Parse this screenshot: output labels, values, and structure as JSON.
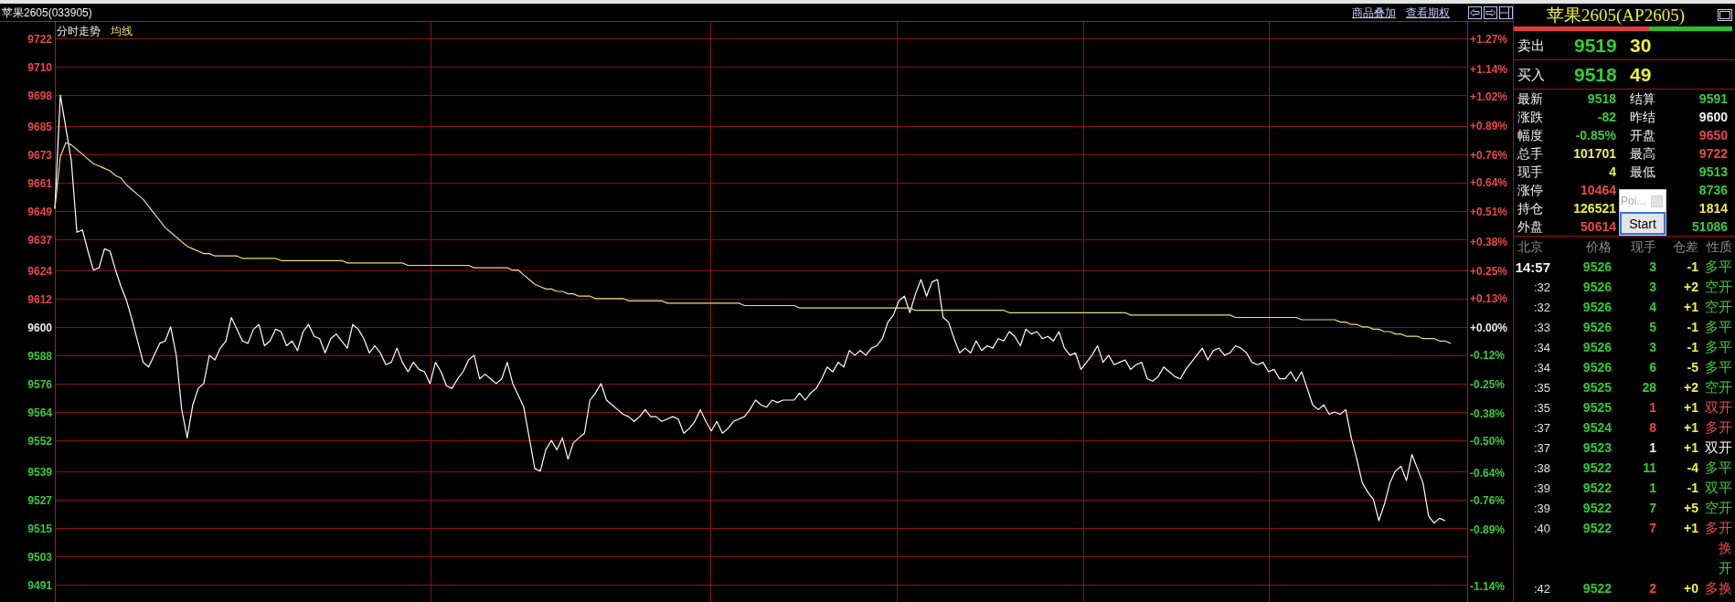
{
  "header": {
    "title": "苹果2605(033905)",
    "links": [
      "商品叠加",
      "查看期权"
    ]
  },
  "chart": {
    "chart_data": {
      "type": "line",
      "title": "分时走势",
      "grid": true,
      "ylim": [
        9483.6,
        9729
      ],
      "y2lim": [
        -1.2125,
        1.34375
      ],
      "yticks": [
        9722,
        9710,
        9698,
        9685,
        9673,
        9661,
        9649,
        9637,
        9624,
        9612,
        9600,
        9588,
        9576,
        9564,
        9552,
        9539,
        9527,
        9515,
        9503,
        9491
      ],
      "y2ticks": [
        {
          "value": 1.27,
          "label": "+1.27%"
        },
        {
          "value": 1.14,
          "label": "+1.14%"
        },
        {
          "value": 1.02,
          "label": "+1.02%"
        },
        {
          "value": 0.89,
          "label": "+0.89%"
        },
        {
          "value": 0.76,
          "label": "+0.76%"
        },
        {
          "value": 0.64,
          "label": "+0.64%"
        },
        {
          "value": 0.51,
          "label": "+0.51%"
        },
        {
          "value": 0.38,
          "label": "+0.38%"
        },
        {
          "value": 0.25,
          "label": "+0.25%"
        },
        {
          "value": 0.13,
          "label": "+0.13%"
        },
        {
          "value": 0,
          "label": "+0.00%"
        },
        {
          "value": -0.12,
          "label": "-0.12%"
        },
        {
          "value": -0.25,
          "label": "-0.25%"
        },
        {
          "value": -0.38,
          "label": "-0.38%"
        },
        {
          "value": -0.5,
          "label": "-0.50%"
        },
        {
          "value": -0.64,
          "label": "-0.64%"
        },
        {
          "value": -0.76,
          "label": "-0.76%"
        },
        {
          "value": -0.89,
          "label": "-0.89%"
        },
        {
          "value": -1.14,
          "label": "-1.14%"
        }
      ],
      "series": [
        {
          "color": "#ffffff",
          "values": [
            9650,
            9698,
            9684,
            9670,
            9640,
            9641,
            9632,
            9624,
            9625,
            9633,
            9632,
            9624,
            9617,
            9611,
            9603,
            9594,
            9585,
            9583,
            9588,
            9593,
            9594,
            9600,
            9588,
            9565,
            9553,
            9567,
            9574,
            9576,
            9588,
            9586,
            9591,
            9594,
            9604,
            9599,
            9594,
            9593,
            9599,
            9601,
            9592,
            9594,
            9599,
            9598,
            9592,
            9594,
            9590,
            9598,
            9601,
            9596,
            9595,
            9589,
            9595,
            9597,
            9594,
            9591,
            9601,
            9599,
            9595,
            9589,
            9592,
            9589,
            9584,
            9585,
            9591,
            9585,
            9581,
            9585,
            9582,
            9581,
            9576,
            9585,
            9581,
            9575,
            9574,
            9578,
            9581,
            9586,
            9588,
            9578,
            9580,
            9578,
            9576,
            9578,
            9585,
            9576,
            9571,
            9566,
            9553,
            9540,
            9539,
            9548,
            9552,
            9548,
            9553,
            9544,
            9551,
            9553,
            9555,
            9569,
            9572,
            9576,
            9569,
            9567,
            9565,
            9563,
            9562,
            9560,
            9562,
            9565,
            9562,
            9562,
            9560,
            9561,
            9562,
            9561,
            9555,
            9557,
            9560,
            9565,
            9560,
            9556,
            9560,
            9555,
            9557,
            9560,
            9561,
            9562,
            9565,
            9569,
            9567,
            9566,
            9569,
            9568,
            9569,
            9569,
            9569,
            9572,
            9569,
            9572,
            9574,
            9578,
            9583,
            9581,
            9585,
            9583,
            9590,
            9588,
            9590,
            9588,
            9591,
            9592,
            9595,
            9602,
            9605,
            9611,
            9613,
            9606,
            9614,
            9620,
            9613,
            9619,
            9620,
            9604,
            9602,
            9595,
            9589,
            9591,
            9589,
            9594,
            9590,
            9592,
            9591,
            9595,
            9594,
            9598,
            9596,
            9592,
            9599,
            9597,
            9598,
            9595,
            9596,
            9594,
            9598,
            9591,
            9588,
            9589,
            9582,
            9585,
            9588,
            9592,
            9585,
            9588,
            9584,
            9585,
            9586,
            9582,
            9584,
            9585,
            9578,
            9577,
            9579,
            9583,
            9581,
            9579,
            9578,
            9582,
            9585,
            9588,
            9591,
            9586,
            9590,
            9591,
            9588,
            9589,
            9592,
            9591,
            9589,
            9585,
            9584,
            9585,
            9581,
            9582,
            9578,
            9578,
            9581,
            9577,
            9581,
            9574,
            9567,
            9565,
            9567,
            9563,
            9564,
            9563,
            9565,
            9553,
            9544,
            9534,
            9530,
            9527,
            9518,
            9525,
            9534,
            9539,
            9541,
            9535,
            9546,
            9540,
            9534,
            9520,
            9517,
            9519,
            9518,
            null,
            null,
            null
          ]
        },
        {
          "name": "均线",
          "color": "#ece07a",
          "values": [
            9650,
            9672,
            9678,
            9677,
            9675,
            9673,
            9671,
            9669,
            9668,
            9667,
            9666,
            9664,
            9663,
            9660,
            9658,
            9656,
            9654,
            9651,
            9648,
            9645,
            9642,
            9640,
            9638,
            9636,
            9634,
            9633,
            9632,
            9631,
            9631,
            9630,
            9630,
            9630,
            9630,
            9630,
            9629,
            9629,
            9629,
            9629,
            9629,
            9629,
            9629,
            9628,
            9628,
            9628,
            9628,
            9628,
            9628,
            9628,
            9628,
            9628,
            9628,
            9628,
            9628,
            9627,
            9627,
            9627,
            9627,
            9627,
            9627,
            9627,
            9627,
            9627,
            9627,
            9627,
            9626,
            9626,
            9626,
            9626,
            9626,
            9626,
            9626,
            9626,
            9626,
            9626,
            9626,
            9626,
            9625,
            9625,
            9625,
            9625,
            9625,
            9625,
            9625,
            9624,
            9624,
            9622,
            9620,
            9618,
            9617,
            9616,
            9616,
            9615,
            9615,
            9614,
            9614,
            9613,
            9613,
            9613,
            9612,
            9612,
            9612,
            9612,
            9612,
            9612,
            9611,
            9611,
            9611,
            9611,
            9611,
            9611,
            9611,
            9610,
            9610,
            9610,
            9610,
            9610,
            9610,
            9610,
            9610,
            9610,
            9610,
            9610,
            9610,
            9610,
            9610,
            9609,
            9609,
            9609,
            9609,
            9609,
            9609,
            9609,
            9609,
            9609,
            9609,
            9608,
            9608,
            9608,
            9608,
            9608,
            9608,
            9608,
            9608,
            9608,
            9608,
            9608,
            9608,
            9608,
            9608,
            9608,
            9608,
            9608,
            9608,
            9608,
            9608,
            9608,
            9607,
            9607,
            9607,
            9607,
            9607,
            9607,
            9607,
            9607,
            9607,
            9607,
            9607,
            9607,
            9607,
            9607,
            9607,
            9607,
            9607,
            9606,
            9606,
            9606,
            9606,
            9606,
            9606,
            9606,
            9606,
            9606,
            9606,
            9606,
            9606,
            9606,
            9606,
            9606,
            9606,
            9606,
            9606,
            9606,
            9606,
            9606,
            9606,
            9605,
            9605,
            9605,
            9605,
            9605,
            9605,
            9605,
            9605,
            9605,
            9605,
            9605,
            9605,
            9605,
            9605,
            9605,
            9605,
            9605,
            9605,
            9605,
            9604,
            9604,
            9604,
            9604,
            9604,
            9604,
            9604,
            9604,
            9604,
            9604,
            9604,
            9604,
            9603,
            9603,
            9603,
            9603,
            9603,
            9603,
            9603,
            9602,
            9602,
            9601,
            9601,
            9600,
            9600,
            9599,
            9599,
            9598,
            9598,
            9597,
            9597,
            9596,
            9596,
            9596,
            9595,
            9595,
            9595,
            9594,
            9594,
            9593,
            null,
            null,
            null
          ]
        }
      ]
    }
  },
  "quote_panel": {
    "title": "苹果2605(AP2605)",
    "ratio_bar": {
      "level": 0.62
    },
    "orders": [
      {
        "label": "卖出",
        "price": "9519",
        "volume": "30"
      },
      {
        "label": "买入",
        "price": "9518",
        "volume": "49"
      }
    ],
    "quote": {
      "left": [
        {
          "label": "最新",
          "value": "9518",
          "color": "#3cc83c"
        },
        {
          "label": "涨跌",
          "value": "-82",
          "color": "#3cc83c"
        },
        {
          "label": "幅度",
          "value": "-0.85%",
          "color": "#3cc83c"
        },
        {
          "label": "总手",
          "value": "101701",
          "color": "#f0f040"
        },
        {
          "label": "现手",
          "value": "4",
          "color": "#f0f040"
        },
        {
          "label": "涨停",
          "value": "10464",
          "color": "#e84848"
        },
        {
          "label": "持仓",
          "value": "126521",
          "color": "#f0f040"
        },
        {
          "label": "外盘",
          "value": "50614",
          "color": "#e84848"
        }
      ],
      "right": [
        {
          "label": "结算",
          "value": "9591",
          "color": "#3cc83c"
        },
        {
          "label": "昨结",
          "value": "9600",
          "color": "#f0f0f0"
        },
        {
          "label": "开盘",
          "value": "9650",
          "color": "#e84848"
        },
        {
          "label": "最高",
          "value": "9722",
          "color": "#e84848"
        },
        {
          "label": "最低",
          "value": "9513",
          "color": "#3cc83c"
        },
        {
          "value": "8736",
          "color": "#3cc83c"
        },
        {
          "value": "1814",
          "color": "#f0f040"
        },
        {
          "value": "51086",
          "color": "#3cc83c"
        }
      ]
    },
    "trades": {
      "columns": [
        "北京",
        "价格",
        "现手",
        "仓差",
        "性质"
      ],
      "rows": [
        {
          "time": "14:57",
          "price": "9526",
          "volume": "3",
          "oi_change": "-1",
          "nature": "多平",
          "color": "#3cc83c"
        },
        {
          "time": ":32",
          "price": "9526",
          "volume": "3",
          "oi_change": "+2",
          "nature": "空开",
          "color": "#3cc83c"
        },
        {
          "time": ":32",
          "price": "9526",
          "volume": "4",
          "oi_change": "+1",
          "nature": "空开",
          "color": "#3cc83c"
        },
        {
          "time": ":33",
          "price": "9526",
          "volume": "5",
          "oi_change": "-1",
          "nature": "多平",
          "color": "#3cc83c"
        },
        {
          "time": ":34",
          "price": "9526",
          "volume": "3",
          "oi_change": "-1",
          "nature": "多平",
          "color": "#3cc83c"
        },
        {
          "time": ":34",
          "price": "9526",
          "volume": "6",
          "oi_change": "-5",
          "nature": "多平",
          "color": "#3cc83c"
        },
        {
          "time": ":35",
          "price": "9525",
          "volume": "28",
          "oi_change": "+2",
          "nature": "空开",
          "color": "#3cc83c"
        },
        {
          "time": ":35",
          "price": "9525",
          "volume": "1",
          "oi_change": "+1",
          "nature": "双开",
          "color": "#e84848"
        },
        {
          "time": ":37",
          "price": "9524",
          "volume": "8",
          "oi_change": "+1",
          "nature": "多开",
          "color": "#e84848"
        },
        {
          "time": ":37",
          "price": "9523",
          "volume": "1",
          "oi_change": "+1",
          "nature": "双开",
          "color": "#f0f0f0"
        },
        {
          "time": ":38",
          "price": "9522",
          "volume": "11",
          "oi_change": "-4",
          "nature": "多平",
          "color": "#3cc83c"
        },
        {
          "time": ":39",
          "price": "9522",
          "volume": "1",
          "oi_change": "-1",
          "nature": "双平",
          "color": "#3cc83c"
        },
        {
          "time": ":39",
          "price": "9522",
          "volume": "7",
          "oi_change": "+5",
          "nature": "空开",
          "color": "#3cc83c"
        },
        {
          "time": ":40",
          "price": "9522",
          "volume": "7",
          "oi_change": "+1",
          "nature": "多开",
          "color": "#e84848"
        },
        {
          "nature": "换",
          "color": "#e84848"
        },
        {
          "nature": "开",
          "color": "#3cc83c"
        },
        {
          "time": ":42",
          "price": "9522",
          "volume": "2",
          "oi_change": "+0",
          "nature": "多换",
          "color": "#e84848"
        }
      ]
    }
  },
  "popup": {
    "label": "Poi...",
    "button": "Start"
  }
}
